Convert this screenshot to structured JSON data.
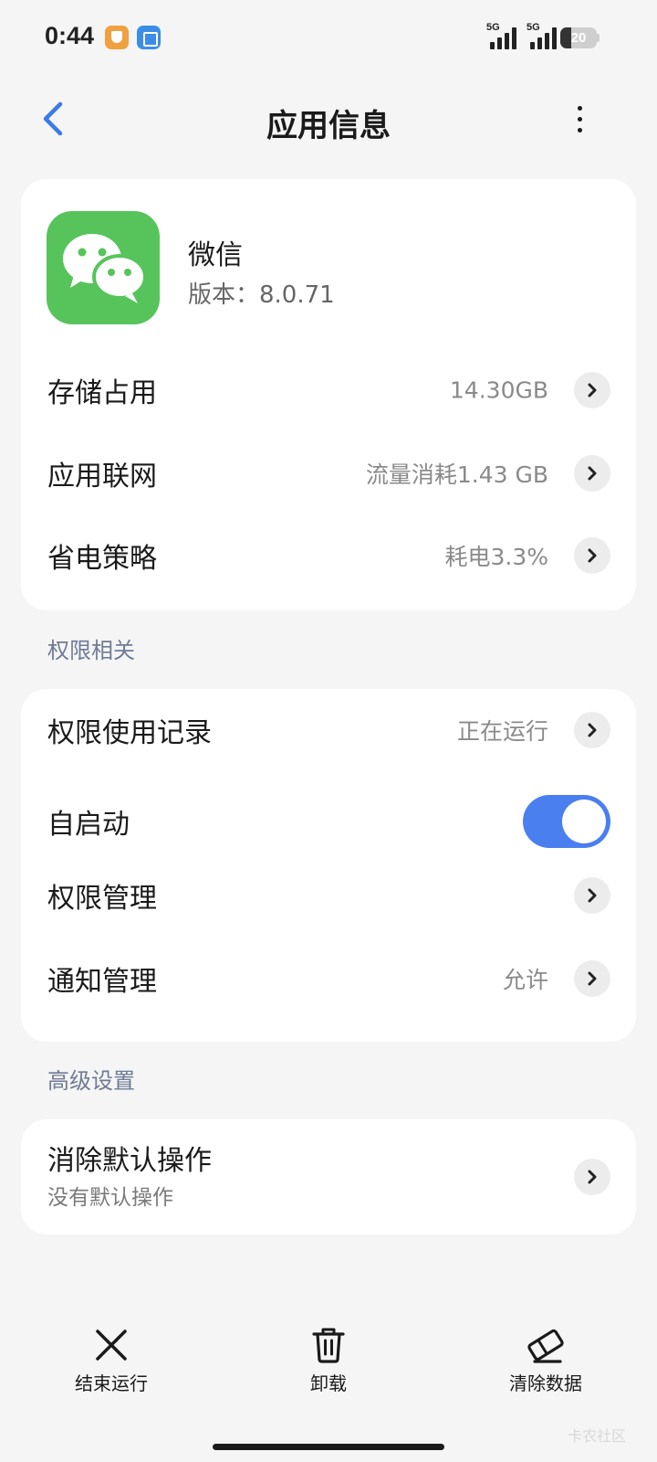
{
  "status_bar": {
    "time": "0:44",
    "network_1": "5G",
    "network_2": "5G",
    "battery": "20"
  },
  "header": {
    "title": "应用信息"
  },
  "app": {
    "name": "微信",
    "version": "版本：8.0.71",
    "icon_color": "#56c45a"
  },
  "rows": {
    "storage": {
      "label": "存储占用",
      "value": "14.30GB"
    },
    "network": {
      "label": "应用联网",
      "value": "流量消耗1.43 GB"
    },
    "battery": {
      "label": "省电策略",
      "value": "耗电3.3%"
    }
  },
  "permissions": {
    "title": "权限相关",
    "usage_record": {
      "label": "权限使用记录",
      "value": "正在运行"
    },
    "autostart": {
      "label": "自启动",
      "enabled": true
    },
    "permission_manage": {
      "label": "权限管理"
    },
    "notification_manage": {
      "label": "通知管理",
      "value": "允许"
    }
  },
  "advanced": {
    "title": "高级设置",
    "clear_defaults": {
      "label": "消除默认操作",
      "sub": "没有默认操作"
    }
  },
  "bottom_actions": {
    "force_stop": "结束运行",
    "uninstall": "卸载",
    "clear_data": "清除数据"
  },
  "accent_color": "#4a7ff0",
  "watermark": "卡农社区"
}
